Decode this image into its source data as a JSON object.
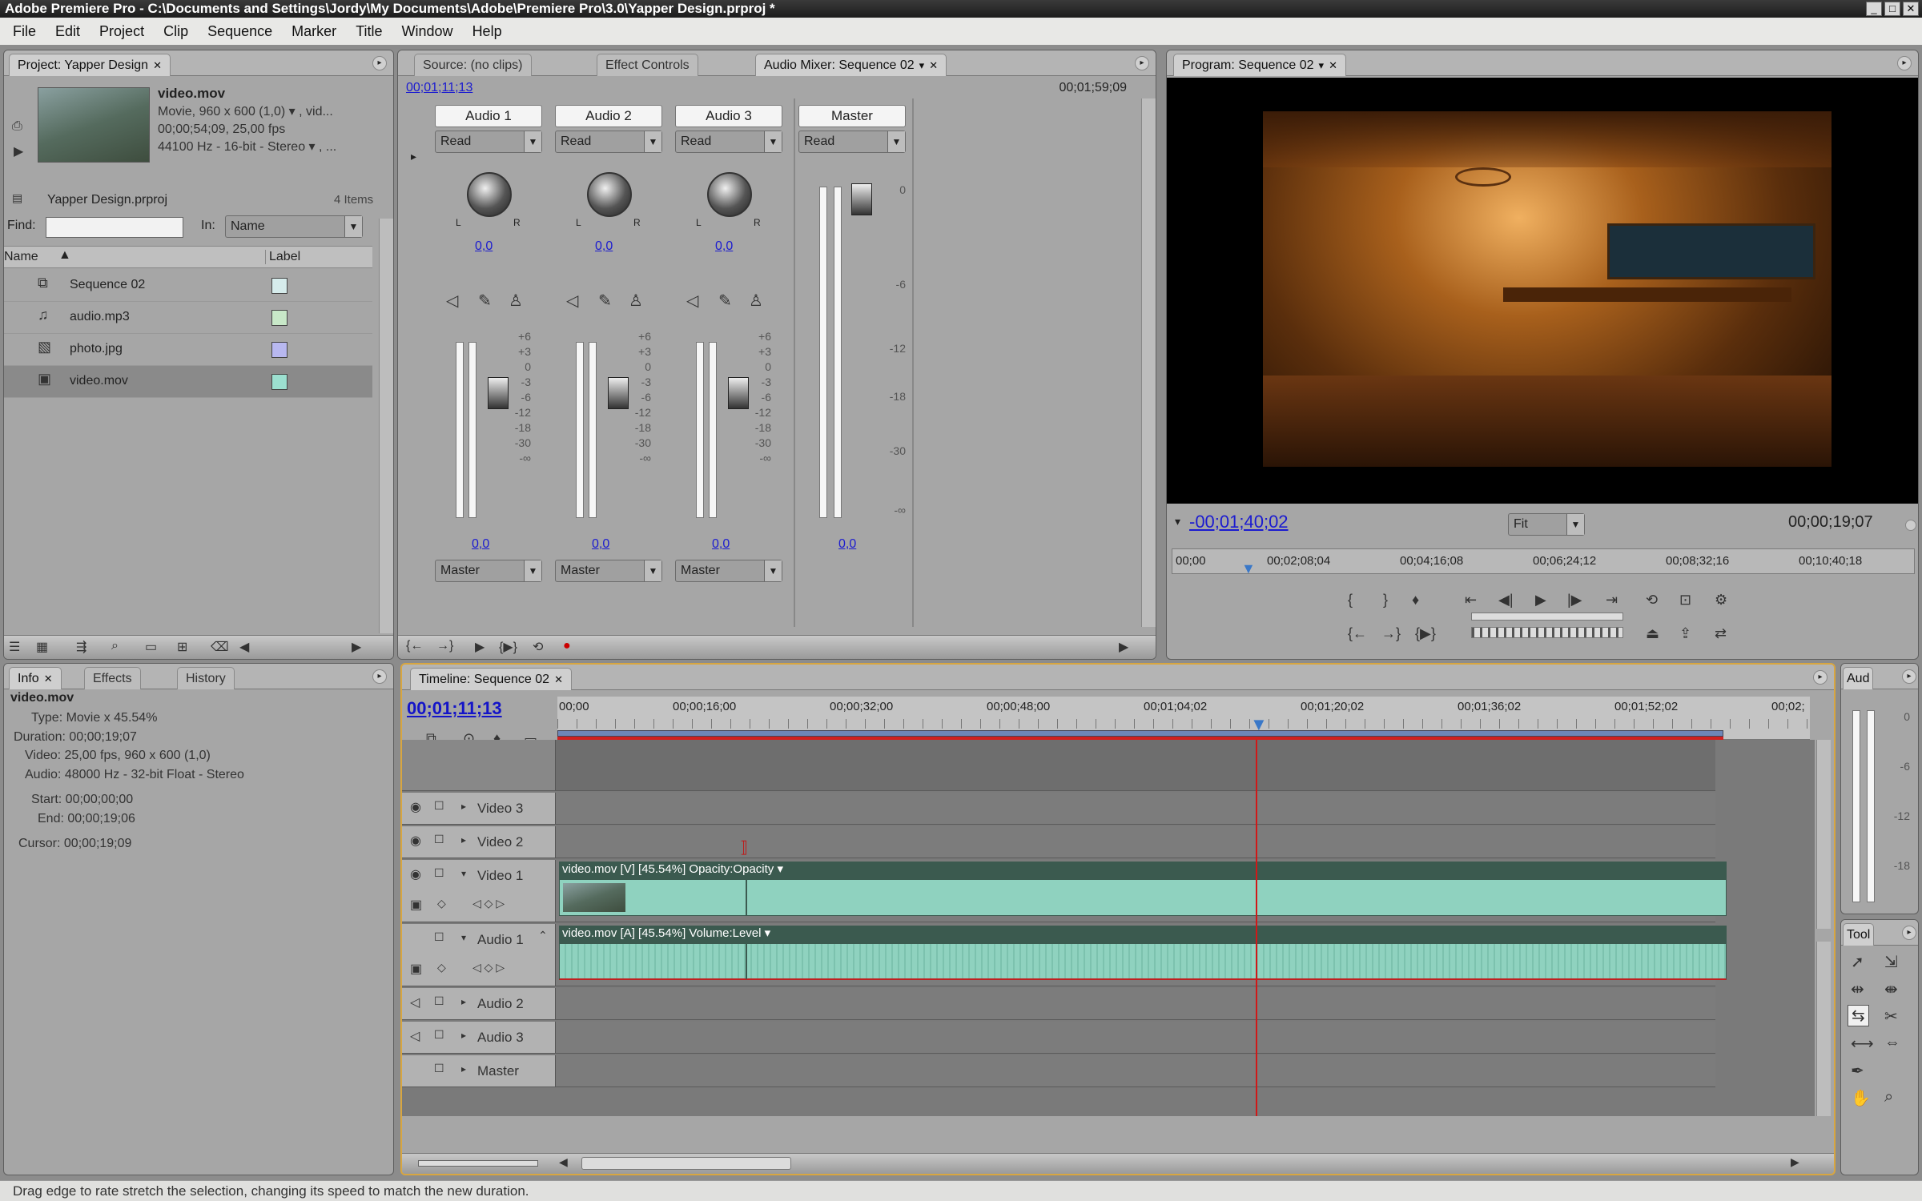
{
  "app": {
    "title": "Adobe Premiere Pro - C:\\Documents and Settings\\Jordy\\My Documents\\Adobe\\Premiere Pro\\3.0\\Yapper Design.prproj *"
  },
  "menu": [
    "File",
    "Edit",
    "Project",
    "Clip",
    "Sequence",
    "Marker",
    "Title",
    "Window",
    "Help"
  ],
  "project": {
    "tab": "Project: Yapper Design",
    "clip_name": "video.mov",
    "clip_info": [
      "Movie, 960 x 600 (1,0) ▾ , vid...",
      "00;00;54;09, 25,00 fps",
      "44100 Hz - 16-bit - Stereo ▾ , ..."
    ],
    "file": "Yapper Design.prproj",
    "count": "4 Items",
    "find_label": "Find:",
    "in_label": "In:",
    "in_value": "Name",
    "col_name": "Name",
    "col_label": "Label",
    "items": [
      {
        "name": "Sequence 02",
        "color": "#d6ecec",
        "icon": "sequence-icon"
      },
      {
        "name": "audio.mp3",
        "color": "#c8e8c8",
        "icon": "audio-file-icon"
      },
      {
        "name": "photo.jpg",
        "color": "#b8b8f0",
        "icon": "image-file-icon"
      },
      {
        "name": "video.mov",
        "color": "#9ce0d0",
        "icon": "video-file-icon"
      }
    ]
  },
  "mixer": {
    "tabs": [
      "Source: (no clips)",
      "Effect Controls",
      "Audio Mixer: Sequence 02"
    ],
    "time_left": "00;01;11;13",
    "time_right": "00;01;59;09",
    "channels": [
      {
        "name": "Audio 1",
        "mode": "Read",
        "pan": "0,0",
        "vol": "0,0",
        "out": "Master"
      },
      {
        "name": "Audio 2",
        "mode": "Read",
        "pan": "0,0",
        "vol": "0,0",
        "out": "Master"
      },
      {
        "name": "Audio 3",
        "mode": "Read",
        "pan": "0,0",
        "vol": "0,0",
        "out": "Master"
      }
    ],
    "master": {
      "name": "Master",
      "mode": "Read",
      "vol": "0,0"
    },
    "scale": [
      "+6",
      "+3",
      "0",
      "-3",
      "-6",
      "-12",
      "-18",
      "-30",
      "-∞"
    ],
    "master_scale": [
      "0",
      "-6",
      "-12",
      "-18",
      "-30",
      "-∞"
    ],
    "knob_l": "L",
    "knob_r": "R"
  },
  "program": {
    "tab": "Program: Sequence 02",
    "timecode": "-00;01;40;02",
    "fit": "Fit",
    "duration": "00;00;19;07",
    "ruler": [
      "00;00",
      "00;02;08;04",
      "00;04;16;08",
      "00;06;24;12",
      "00;08;32;16",
      "00;10;40;18"
    ]
  },
  "info": {
    "tabs": [
      "Info",
      "Effects",
      "History"
    ],
    "title": "video.mov",
    "lines": [
      "Type: Movie x 45.54%",
      "Duration: 00;00;19;07",
      "Video: 25,00 fps, 960 x 600 (1,0)",
      "Audio: 48000 Hz - 32-bit Float - Stereo",
      "",
      "Start: 00;00;00;00",
      "End: 00;00;19;06",
      "",
      "Cursor: 00;00;19;09"
    ]
  },
  "timeline": {
    "tab": "Timeline: Sequence 02",
    "timecode": "00;01;11;13",
    "ruler": [
      "00;00",
      "00;00;16;00",
      "00;00;32;00",
      "00;00;48;00",
      "00;01;04;02",
      "00;01;20;02",
      "00;01;36;02",
      "00;01;52;02",
      "00;02;"
    ],
    "tracks": [
      "Video 3",
      "Video 2",
      "Video 1",
      "Audio 1",
      "Audio 2",
      "Audio 3",
      "Master"
    ],
    "video_clip": "video.mov [V] [45.54%] Opacity:Opacity ▾",
    "audio_clip": "video.mov [A] [45.54%] Volume:Level ▾"
  },
  "audio_meter": {
    "tab": "Aud",
    "scale": [
      "0",
      "-6",
      "-12",
      "-18"
    ]
  },
  "tools": {
    "tab": "Tool"
  },
  "status": "Drag edge to rate stretch the selection, changing its speed to match the new duration."
}
